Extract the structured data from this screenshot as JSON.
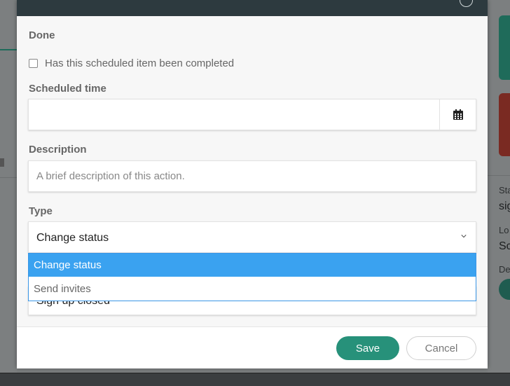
{
  "background": {
    "right_panel": {
      "label1": "Sta",
      "value1": "sig",
      "label2": "Lo",
      "value2": "Sc",
      "label3": "De"
    }
  },
  "modal": {
    "done_label": "Done",
    "completed_checkbox_label": "Has this scheduled item been completed",
    "completed_checked": false,
    "scheduled_time_label": "Scheduled time",
    "scheduled_time_value": "",
    "description_label": "Description",
    "description_placeholder": "A brief description of this action.",
    "type_label": "Type",
    "type_selected": "Change status",
    "type_options": [
      "Change status",
      "Send invites"
    ],
    "obscured_field_value": "Sign up closed",
    "save_label": "Save",
    "cancel_label": "Cancel"
  },
  "colors": {
    "header": "#2d3a3f",
    "save_button": "#27917a",
    "dropdown_highlight": "#3aa2f0"
  },
  "icons": [
    "close-icon",
    "calendar-icon",
    "chevron-down-icon"
  ]
}
